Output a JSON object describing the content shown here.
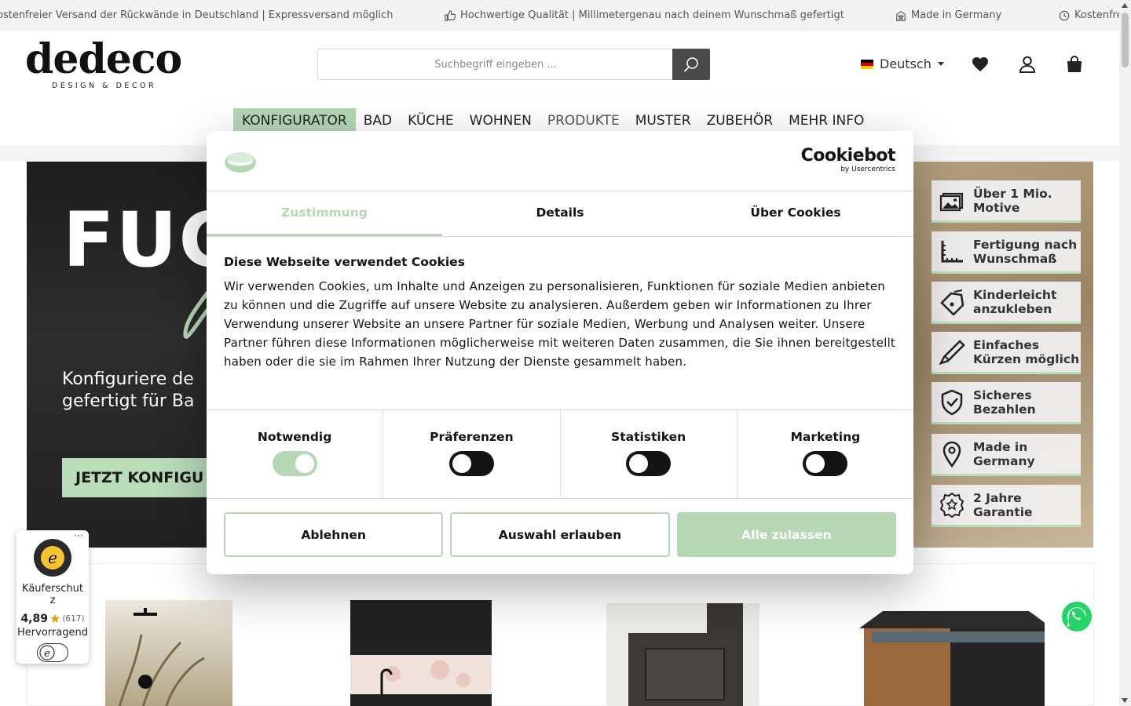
{
  "ticker": {
    "items": [
      {
        "text": "ostenfreier Versand der Rückwände in Deutschland | Expressversand möglich",
        "icon": ""
      },
      {
        "text": "Hochwertige Qualität | Millimetergenau nach deinem Wunschmaß gefertigt",
        "icon": "thumbs-up-icon"
      },
      {
        "text": "Made in Germany",
        "icon": "building-icon"
      },
      {
        "text": "Kostenfre",
        "icon": "clock-icon"
      }
    ]
  },
  "header": {
    "logo_main": "dedeco",
    "logo_sub": "DESIGN & DECOR",
    "search_placeholder": "Suchbegriff eingeben ...",
    "language": "Deutsch"
  },
  "nav": {
    "items": [
      {
        "label": "KONFIGURATOR",
        "state": "active"
      },
      {
        "label": "BAD",
        "state": ""
      },
      {
        "label": "KÜCHE",
        "state": ""
      },
      {
        "label": "WOHNEN",
        "state": ""
      },
      {
        "label": "PRODUKTE",
        "state": "muted"
      },
      {
        "label": "MUSTER",
        "state": ""
      },
      {
        "label": "ZUBEHÖR",
        "state": ""
      },
      {
        "label": "MEHR INFO",
        "state": ""
      }
    ]
  },
  "hero": {
    "title": "FUG",
    "subtitle_line1": "Konfiguriere de",
    "subtitle_line2": "gefertigt für Ba",
    "cta": "JETZT KONFIGU",
    "features": [
      {
        "label": "Über 1 Mio.\nMotive",
        "icon": "image-icon"
      },
      {
        "label": "Fertigung nach\nWunschmaß",
        "icon": "ruler-icon"
      },
      {
        "label": "Kinderleicht\nanzukleben",
        "icon": "tag-icon"
      },
      {
        "label": "Einfaches\nKürzen möglich",
        "icon": "cutter-icon"
      },
      {
        "label": "Sicheres\nBezahlen",
        "icon": "shield-check-icon"
      },
      {
        "label": "Made in\nGermany",
        "icon": "location-pin-icon"
      },
      {
        "label": "2 Jahre\nGarantie",
        "icon": "award-icon"
      }
    ]
  },
  "cookie": {
    "brand": "Cookiebot",
    "brand_by": "by Usercentrics",
    "tabs": [
      "Zustimmung",
      "Details",
      "Über Cookies"
    ],
    "title": "Diese Webseite verwendet Cookies",
    "text": "Wir verwenden Cookies, um Inhalte und Anzeigen zu personalisieren, Funktionen für soziale Medien anbieten zu können und die Zugriffe auf unsere Website zu analysieren. Außerdem geben wir Informationen zu Ihrer Verwendung unserer Website an unsere Partner für soziale Medien, Werbung und Analysen weiter. Unsere Partner führen diese Informationen möglicherweise mit weiteren Daten zusammen, die Sie ihnen bereitgestellt haben oder die sie im Rahmen Ihrer Nutzung der Dienste gesammelt haben.",
    "categories": [
      {
        "label": "Notwendig",
        "enabled": true
      },
      {
        "label": "Präferenzen",
        "enabled": false
      },
      {
        "label": "Statistiken",
        "enabled": false
      },
      {
        "label": "Marketing",
        "enabled": false
      }
    ],
    "buttons": {
      "reject": "Ablehnen",
      "allow_selection": "Auswahl erlauben",
      "allow_all": "Alle zulassen"
    }
  },
  "trusted_shops": {
    "menu": "···",
    "label": "Käuferschutz",
    "score": "4,89",
    "count": "(617)",
    "grade": "Hervorragend"
  },
  "colors": {
    "accent_green": "#b5d7b5",
    "dark": "#141414",
    "search_button": "#4a4a4a"
  }
}
